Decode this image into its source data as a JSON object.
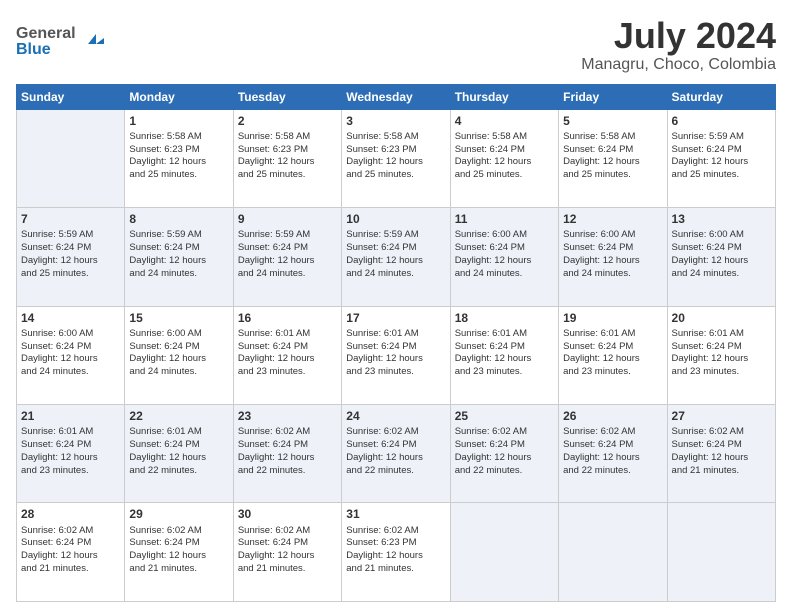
{
  "header": {
    "logo_general": "General",
    "logo_blue": "Blue",
    "month_title": "July 2024",
    "location": "Managru, Choco, Colombia"
  },
  "calendar": {
    "weekdays": [
      "Sunday",
      "Monday",
      "Tuesday",
      "Wednesday",
      "Thursday",
      "Friday",
      "Saturday"
    ],
    "weeks": [
      [
        {
          "day": "",
          "info": ""
        },
        {
          "day": "1",
          "info": "Sunrise: 5:58 AM\nSunset: 6:23 PM\nDaylight: 12 hours\nand 25 minutes."
        },
        {
          "day": "2",
          "info": "Sunrise: 5:58 AM\nSunset: 6:23 PM\nDaylight: 12 hours\nand 25 minutes."
        },
        {
          "day": "3",
          "info": "Sunrise: 5:58 AM\nSunset: 6:23 PM\nDaylight: 12 hours\nand 25 minutes."
        },
        {
          "day": "4",
          "info": "Sunrise: 5:58 AM\nSunset: 6:24 PM\nDaylight: 12 hours\nand 25 minutes."
        },
        {
          "day": "5",
          "info": "Sunrise: 5:58 AM\nSunset: 6:24 PM\nDaylight: 12 hours\nand 25 minutes."
        },
        {
          "day": "6",
          "info": "Sunrise: 5:59 AM\nSunset: 6:24 PM\nDaylight: 12 hours\nand 25 minutes."
        }
      ],
      [
        {
          "day": "7",
          "info": "Sunrise: 5:59 AM\nSunset: 6:24 PM\nDaylight: 12 hours\nand 25 minutes."
        },
        {
          "day": "8",
          "info": "Sunrise: 5:59 AM\nSunset: 6:24 PM\nDaylight: 12 hours\nand 24 minutes."
        },
        {
          "day": "9",
          "info": "Sunrise: 5:59 AM\nSunset: 6:24 PM\nDaylight: 12 hours\nand 24 minutes."
        },
        {
          "day": "10",
          "info": "Sunrise: 5:59 AM\nSunset: 6:24 PM\nDaylight: 12 hours\nand 24 minutes."
        },
        {
          "day": "11",
          "info": "Sunrise: 6:00 AM\nSunset: 6:24 PM\nDaylight: 12 hours\nand 24 minutes."
        },
        {
          "day": "12",
          "info": "Sunrise: 6:00 AM\nSunset: 6:24 PM\nDaylight: 12 hours\nand 24 minutes."
        },
        {
          "day": "13",
          "info": "Sunrise: 6:00 AM\nSunset: 6:24 PM\nDaylight: 12 hours\nand 24 minutes."
        }
      ],
      [
        {
          "day": "14",
          "info": "Sunrise: 6:00 AM\nSunset: 6:24 PM\nDaylight: 12 hours\nand 24 minutes."
        },
        {
          "day": "15",
          "info": "Sunrise: 6:00 AM\nSunset: 6:24 PM\nDaylight: 12 hours\nand 24 minutes."
        },
        {
          "day": "16",
          "info": "Sunrise: 6:01 AM\nSunset: 6:24 PM\nDaylight: 12 hours\nand 23 minutes."
        },
        {
          "day": "17",
          "info": "Sunrise: 6:01 AM\nSunset: 6:24 PM\nDaylight: 12 hours\nand 23 minutes."
        },
        {
          "day": "18",
          "info": "Sunrise: 6:01 AM\nSunset: 6:24 PM\nDaylight: 12 hours\nand 23 minutes."
        },
        {
          "day": "19",
          "info": "Sunrise: 6:01 AM\nSunset: 6:24 PM\nDaylight: 12 hours\nand 23 minutes."
        },
        {
          "day": "20",
          "info": "Sunrise: 6:01 AM\nSunset: 6:24 PM\nDaylight: 12 hours\nand 23 minutes."
        }
      ],
      [
        {
          "day": "21",
          "info": "Sunrise: 6:01 AM\nSunset: 6:24 PM\nDaylight: 12 hours\nand 23 minutes."
        },
        {
          "day": "22",
          "info": "Sunrise: 6:01 AM\nSunset: 6:24 PM\nDaylight: 12 hours\nand 22 minutes."
        },
        {
          "day": "23",
          "info": "Sunrise: 6:02 AM\nSunset: 6:24 PM\nDaylight: 12 hours\nand 22 minutes."
        },
        {
          "day": "24",
          "info": "Sunrise: 6:02 AM\nSunset: 6:24 PM\nDaylight: 12 hours\nand 22 minutes."
        },
        {
          "day": "25",
          "info": "Sunrise: 6:02 AM\nSunset: 6:24 PM\nDaylight: 12 hours\nand 22 minutes."
        },
        {
          "day": "26",
          "info": "Sunrise: 6:02 AM\nSunset: 6:24 PM\nDaylight: 12 hours\nand 22 minutes."
        },
        {
          "day": "27",
          "info": "Sunrise: 6:02 AM\nSunset: 6:24 PM\nDaylight: 12 hours\nand 21 minutes."
        }
      ],
      [
        {
          "day": "28",
          "info": "Sunrise: 6:02 AM\nSunset: 6:24 PM\nDaylight: 12 hours\nand 21 minutes."
        },
        {
          "day": "29",
          "info": "Sunrise: 6:02 AM\nSunset: 6:24 PM\nDaylight: 12 hours\nand 21 minutes."
        },
        {
          "day": "30",
          "info": "Sunrise: 6:02 AM\nSunset: 6:24 PM\nDaylight: 12 hours\nand 21 minutes."
        },
        {
          "day": "31",
          "info": "Sunrise: 6:02 AM\nSunset: 6:23 PM\nDaylight: 12 hours\nand 21 minutes."
        },
        {
          "day": "",
          "info": ""
        },
        {
          "day": "",
          "info": ""
        },
        {
          "day": "",
          "info": ""
        }
      ]
    ]
  }
}
